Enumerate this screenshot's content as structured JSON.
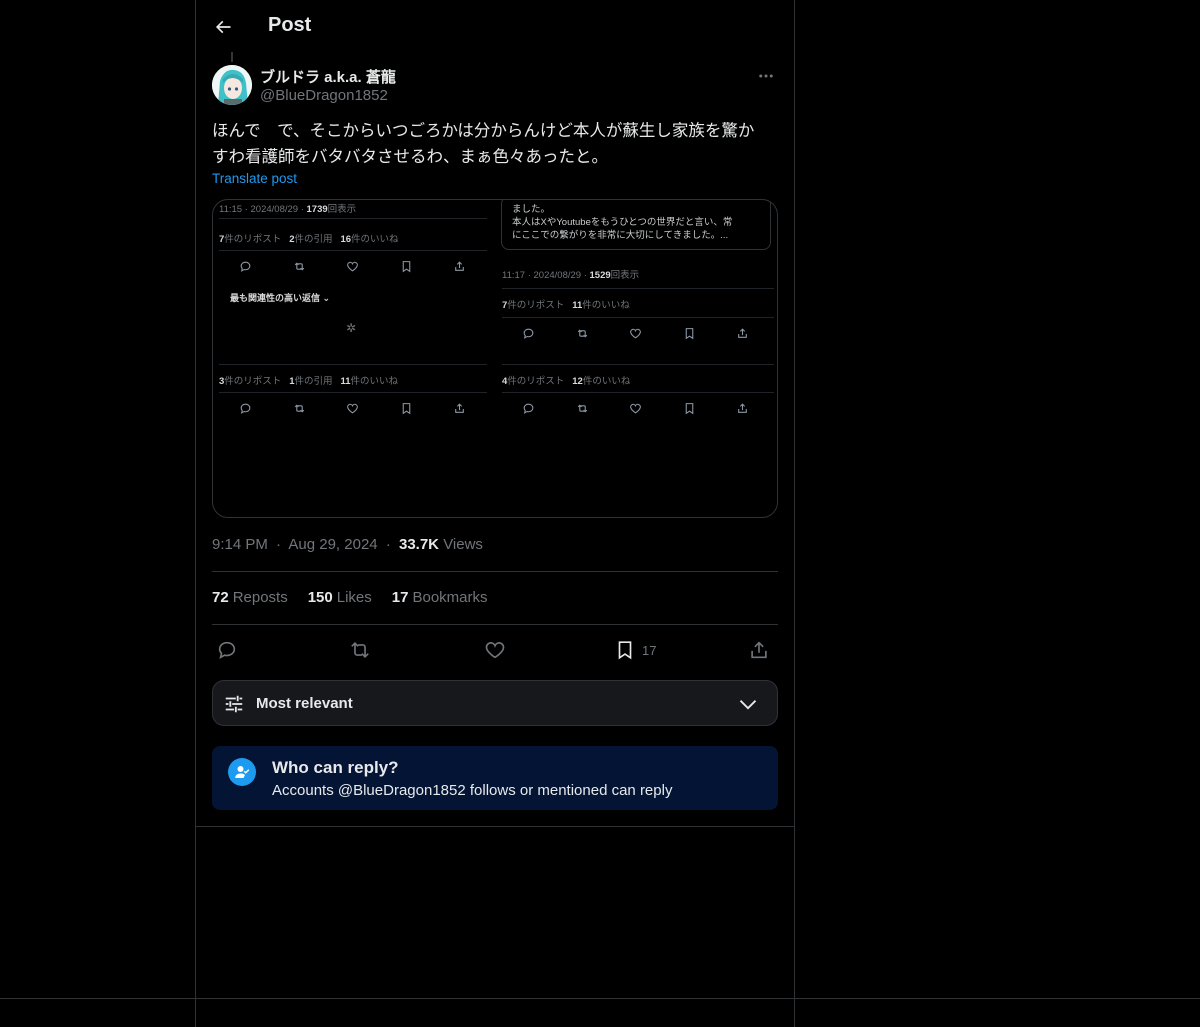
{
  "header": {
    "title": "Post"
  },
  "author": {
    "name": "ブルドラ a.k.a. 蒼龍",
    "handle": "@BlueDragon1852"
  },
  "post": {
    "text_line1": "ほんで　で、そこからいつごろかは分からんけど本人が蘇生し家族を驚か",
    "text_line2": "すわ看護師をバタバタさせるわ、まぁ色々あったと。",
    "translate_label": "Translate post"
  },
  "media": {
    "left": {
      "timestamp": "11:15 · 2024/08/29 ·",
      "views_count": "1739",
      "views_label": "回表示",
      "stats1": {
        "repost_count": "7",
        "repost_label": "件のリポスト",
        "quote_count": "2",
        "quote_label": "件の引用",
        "like_count": "16",
        "like_label": "件のいいね"
      },
      "sort_label": "最も関連性の高い返信",
      "stats2": {
        "repost_count": "3",
        "repost_label": "件のリポスト",
        "quote_count": "1",
        "quote_label": "件の引用",
        "like_count": "11",
        "like_label": "件のいいね"
      }
    },
    "right": {
      "quote_line1": "ました。",
      "quote_line2": "本人はXやYoutubeをもうひとつの世界だと言い、常",
      "quote_line3": "にここでの繋がりを非常に大切にしてきました。...",
      "timestamp": "11:17 · 2024/08/29 ·",
      "views_count": "1529",
      "views_label": "回表示",
      "stats1": {
        "repost_count": "7",
        "repost_label": "件のリポスト",
        "like_count": "11",
        "like_label": "件のいいね"
      },
      "stats2": {
        "repost_count": "4",
        "repost_label": "件のリポスト",
        "like_count": "12",
        "like_label": "件のいいね"
      }
    }
  },
  "meta": {
    "time": "9:14 PM",
    "sep": "·",
    "date": "Aug 29, 2024",
    "views_count": "33.7K",
    "views_label": "Views"
  },
  "stats": {
    "reposts_count": "72",
    "reposts_label": "Reposts",
    "likes_count": "150",
    "likes_label": "Likes",
    "bookmarks_count": "17",
    "bookmarks_label": "Bookmarks"
  },
  "actions": {
    "bookmark_count": "17"
  },
  "sort": {
    "label": "Most relevant"
  },
  "reply_restriction": {
    "title": "Who can reply?",
    "subtitle": "Accounts @BlueDragon1852 follows or mentioned can reply"
  },
  "colors": {
    "background": "#000000",
    "text": "#e7e9ea",
    "muted": "#71767b",
    "accent": "#1d9bf0",
    "border": "#2f3336",
    "notice_bg": "#031434"
  }
}
